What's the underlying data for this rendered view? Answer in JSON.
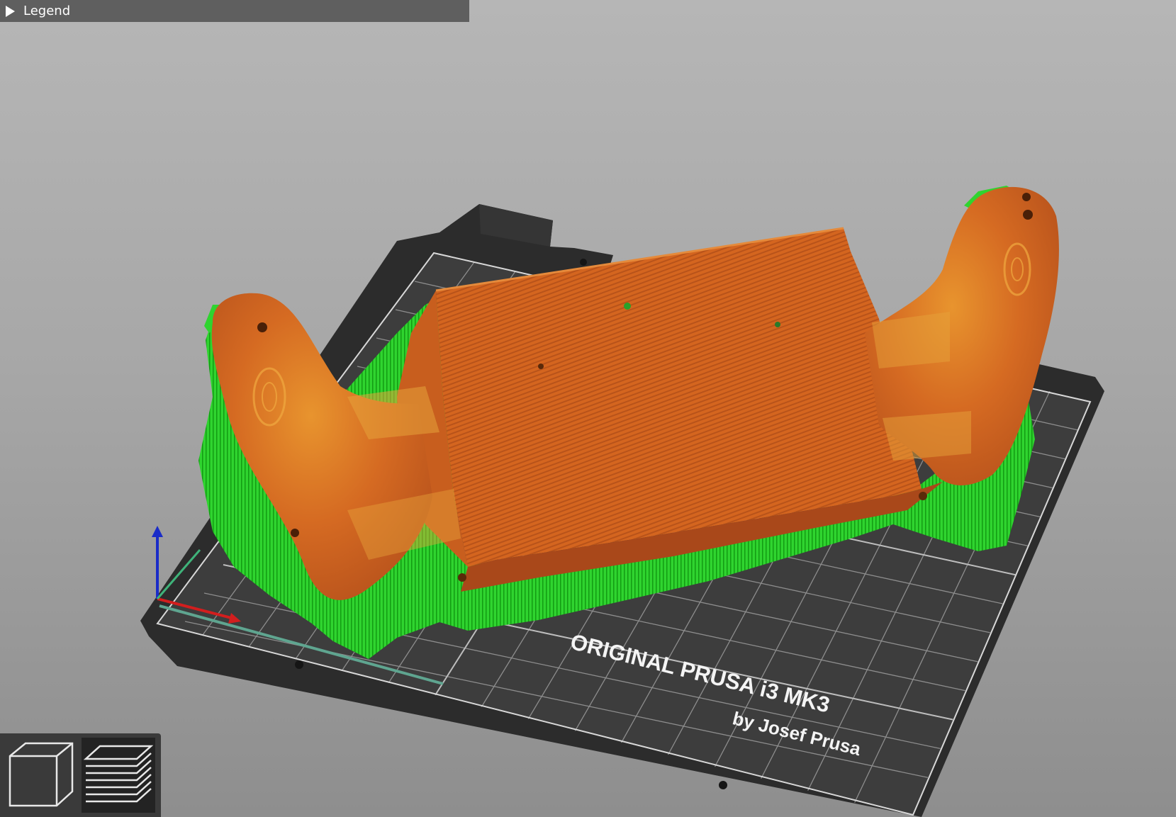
{
  "legend": {
    "label": "Legend"
  },
  "bed": {
    "brand_line1": "ORIGINAL PRUSA i3 MK3",
    "brand_line2": "by Josef Prusa"
  },
  "view_toolbar": {
    "buttons": [
      {
        "name": "3d-view",
        "icon": "cube-icon",
        "active": false
      },
      {
        "name": "preview",
        "icon": "layers-icon",
        "active": true
      }
    ]
  },
  "colors": {
    "model": "#d4651f",
    "support": "#22d322",
    "bed_plate": "#3a3a3a",
    "bed_frame": "#2c2c2c",
    "axis_x": "#d21e1e",
    "axis_y": "#3fb37a",
    "axis_z": "#1a2cc8"
  }
}
